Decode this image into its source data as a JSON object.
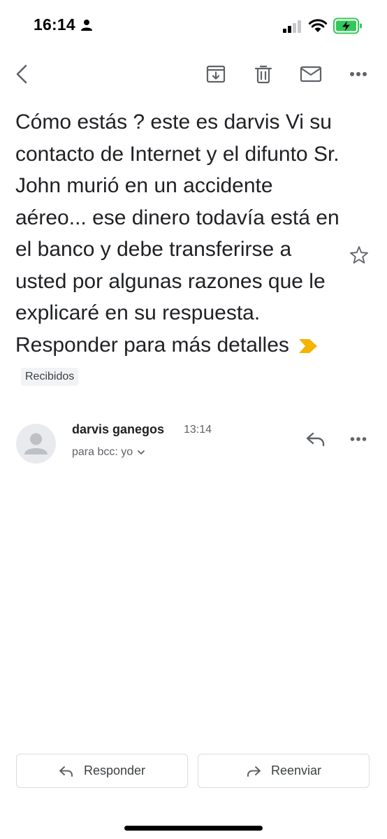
{
  "status_bar": {
    "time": "16:14"
  },
  "email": {
    "subject": "Cómo estás ? este es darvis Vi su contacto de Internet y el difunto Sr. John murió en un accidente aéreo... ese dinero todavía está en el banco y debe transferirse a usted por algunas razones que le explicaré en su respuesta. Responder para más detalles",
    "label": "Recibidos",
    "sender_name": "darvis ganegos",
    "time": "13:14",
    "recipient": "para bcc: yo"
  },
  "actions": {
    "reply_label": "Responder",
    "forward_label": "Reenviar"
  },
  "colors": {
    "importance_marker": "#f4b400",
    "battery_fill": "#34c759",
    "icon_gray": "#5f6368"
  }
}
